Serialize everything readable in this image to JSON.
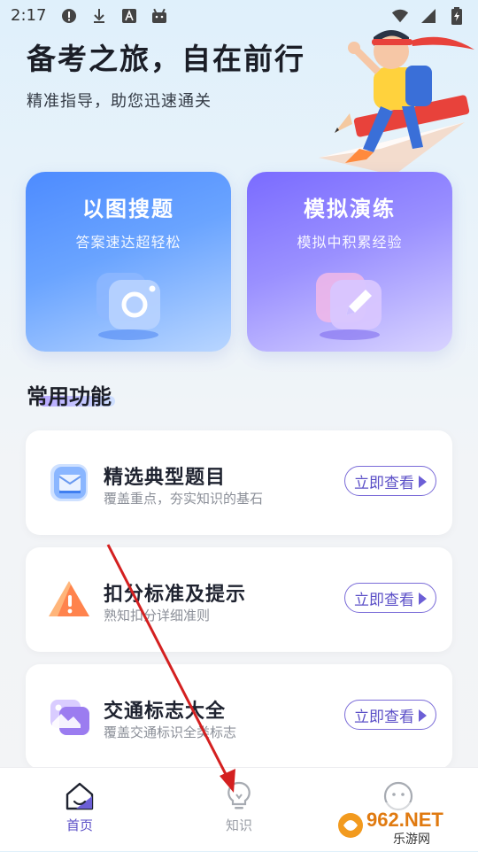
{
  "status_bar": {
    "time": "2:17"
  },
  "hero": {
    "title": "备考之旅，自在前行",
    "subtitle": "精准指导，助您迅速通关"
  },
  "feature_cards": [
    {
      "title": "以图搜题",
      "subtitle": "答案速达超轻松",
      "icon": "camera-icon",
      "color": "#4d8bff"
    },
    {
      "title": "模拟演练",
      "subtitle": "模拟中积累经验",
      "icon": "pencil-icon",
      "color": "#7a6bff"
    }
  ],
  "common_functions": {
    "title": "常用功能",
    "items": [
      {
        "title": "精选典型题目",
        "subtitle": "覆盖重点，夯实知识的基石",
        "button": "立即查看",
        "icon": "envelope-icon"
      },
      {
        "title": "扣分标准及提示",
        "subtitle": "熟知扣分详细准则",
        "button": "立即查看",
        "icon": "warning-icon"
      },
      {
        "title": "交通标志大全",
        "subtitle": "覆盖交通标识全类标志",
        "button": "立即查看",
        "icon": "image-icon"
      }
    ]
  },
  "tab_bar": {
    "tabs": [
      {
        "label": "首页",
        "icon": "home-icon",
        "active": true
      },
      {
        "label": "知识",
        "icon": "lightbulb-icon",
        "active": false
      },
      {
        "label": "",
        "icon": "smiley-icon",
        "active": false
      }
    ]
  },
  "watermark": {
    "text": "962.NET",
    "sub": "乐游网"
  },
  "colors": {
    "accent": "#5b4fc7",
    "annotation_arrow": "#d42020"
  }
}
